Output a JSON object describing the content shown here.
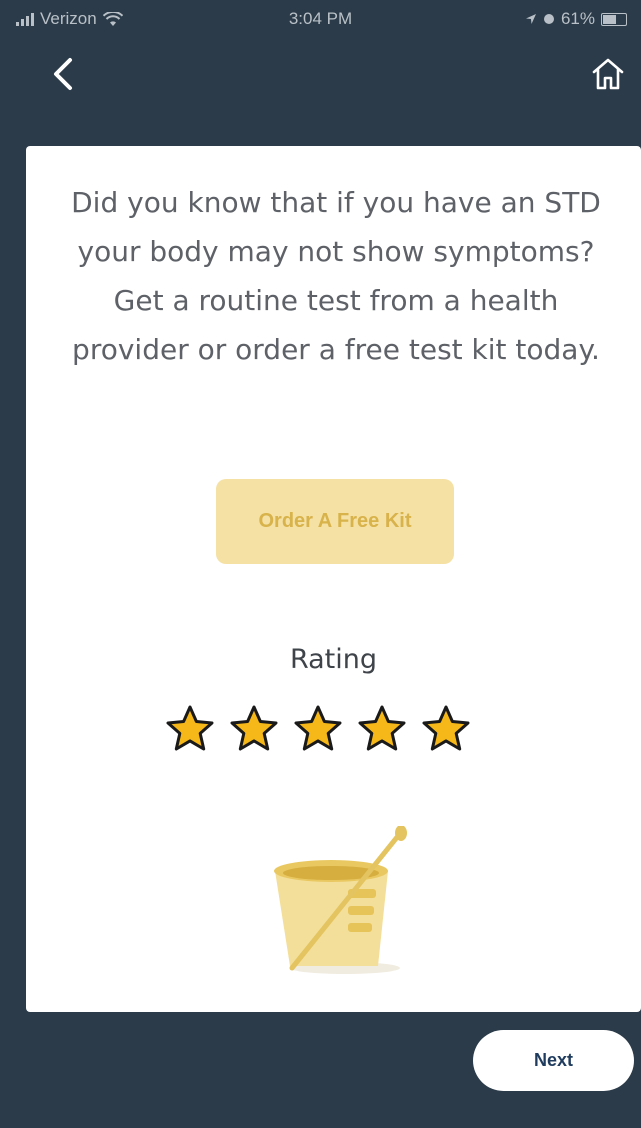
{
  "status_bar": {
    "carrier": "Verizon",
    "time": "3:04 PM",
    "battery": "61%"
  },
  "nav": {
    "back_icon": "chevron-left-icon",
    "home_icon": "home-icon"
  },
  "card": {
    "message": "Did you know that if you have an STD your body may not show symptoms? Get a routine test from a health provider or order a free test kit today.",
    "order_button_label": "Order A Free Kit",
    "rating_label": "Rating",
    "rating": {
      "value": 5,
      "max": 5
    }
  },
  "footer": {
    "next_label": "Next"
  },
  "colors": {
    "background": "#2b3b49",
    "card": "#ffffff",
    "accent_button": "#f5e1a4",
    "accent_text": "#d8b24a",
    "star_fill": "#f6b818",
    "next_text": "#1f3b5d"
  }
}
